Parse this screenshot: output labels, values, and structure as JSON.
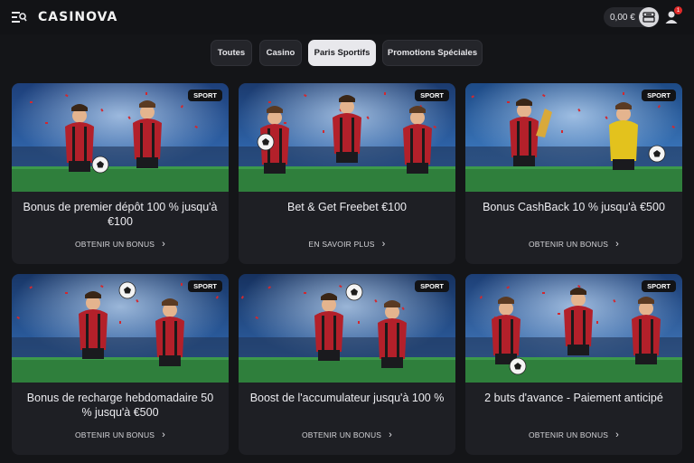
{
  "header": {
    "logo": "CASINOVA",
    "balance": "0,00 €",
    "notification_count": "1"
  },
  "tabs": [
    {
      "label": "Toutes",
      "active": false
    },
    {
      "label": "Casino",
      "active": false
    },
    {
      "label": "Paris Sportifs",
      "active": true
    },
    {
      "label": "Promotions Spéciales",
      "active": false
    }
  ],
  "cards": [
    {
      "badge": "SPORT",
      "title": "Bonus de premier dépôt 100 % jusqu'à €100",
      "link": "OBTENIR UN BONUS"
    },
    {
      "badge": "SPORT",
      "title": "Bet & Get Freebet €100",
      "link": "EN SAVOIR PLUS"
    },
    {
      "badge": "SPORT",
      "title": "Bonus CashBack 10 % jusqu'à €500",
      "link": "OBTENIR UN BONUS"
    },
    {
      "badge": "SPORT",
      "title": "Bonus de recharge hebdomadaire 50 % jusqu'à €500",
      "link": "OBTENIR UN BONUS"
    },
    {
      "badge": "SPORT",
      "title": "Boost de l'accumulateur jusqu'à 100 %",
      "link": "OBTENIR UN BONUS"
    },
    {
      "badge": "SPORT",
      "title": "2 buts d'avance - Paiement anticipé",
      "link": "OBTENIR UN BONUS"
    }
  ],
  "colors": {
    "background": "#141518",
    "card": "#1e1f24",
    "active_tab": "#e8e8ec",
    "jersey_red": "#b3202a",
    "notification": "#e02a2a"
  },
  "icons": [
    "menu-icon",
    "deposit-icon",
    "user-icon",
    "chevron-right-icon",
    "football-icon"
  ]
}
